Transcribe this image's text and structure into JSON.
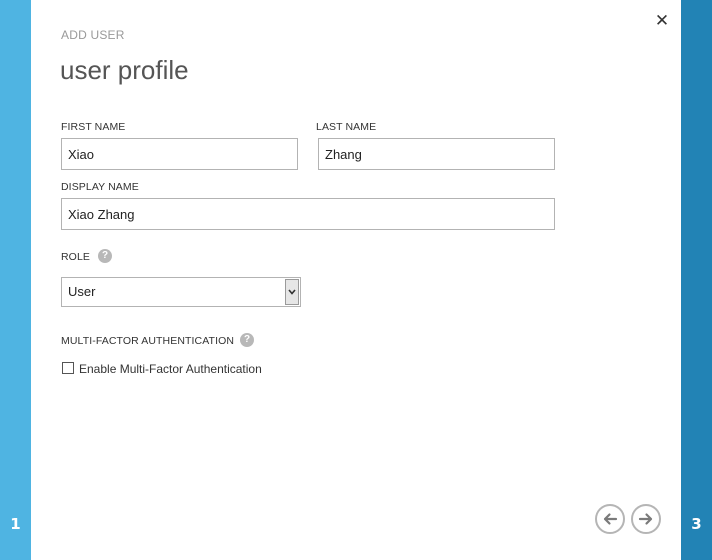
{
  "steps": {
    "left_number": "1",
    "right_number": "3"
  },
  "dialog": {
    "subtitle": "ADD USER",
    "title": "user profile",
    "close_icon": "close-icon",
    "close_glyph": "✕"
  },
  "form": {
    "first_name": {
      "label": "FIRST NAME",
      "value": "Xiao"
    },
    "last_name": {
      "label": "LAST NAME",
      "value": "Zhang"
    },
    "display_name": {
      "label": "DISPLAY NAME",
      "value": "Xiao Zhang"
    },
    "role": {
      "label": "ROLE",
      "value": "User",
      "help_glyph": "?"
    },
    "mfa": {
      "label": "MULTI-FACTOR AUTHENTICATION",
      "help_glyph": "?",
      "checkbox_label": "Enable Multi-Factor Authentication",
      "checked": false
    }
  },
  "navigation": {
    "back_icon": "arrow-left-icon",
    "next_icon": "arrow-right-icon"
  },
  "colors": {
    "left_strip": "#4fb4e2",
    "right_strip": "#2283b5",
    "nav_circle": "#b5b5b5",
    "nav_arrow": "#7a7a7a"
  }
}
